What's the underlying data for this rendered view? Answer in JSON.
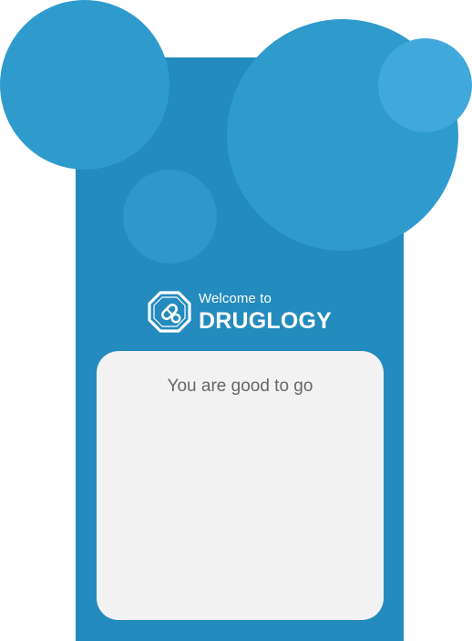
{
  "brand": {
    "welcome_text": "Welcome to",
    "app_name": "DRUGLOGY",
    "logo_icon": "pill-octagon-icon"
  },
  "card": {
    "message": "You are good to go"
  },
  "colors": {
    "panel_background": "#238bbd",
    "bubble": "#2f9bcd",
    "bubble_light": "#40a8da",
    "card_background": "#f2f2f2",
    "message_text": "#676767",
    "brand_text": "#ffffff"
  }
}
